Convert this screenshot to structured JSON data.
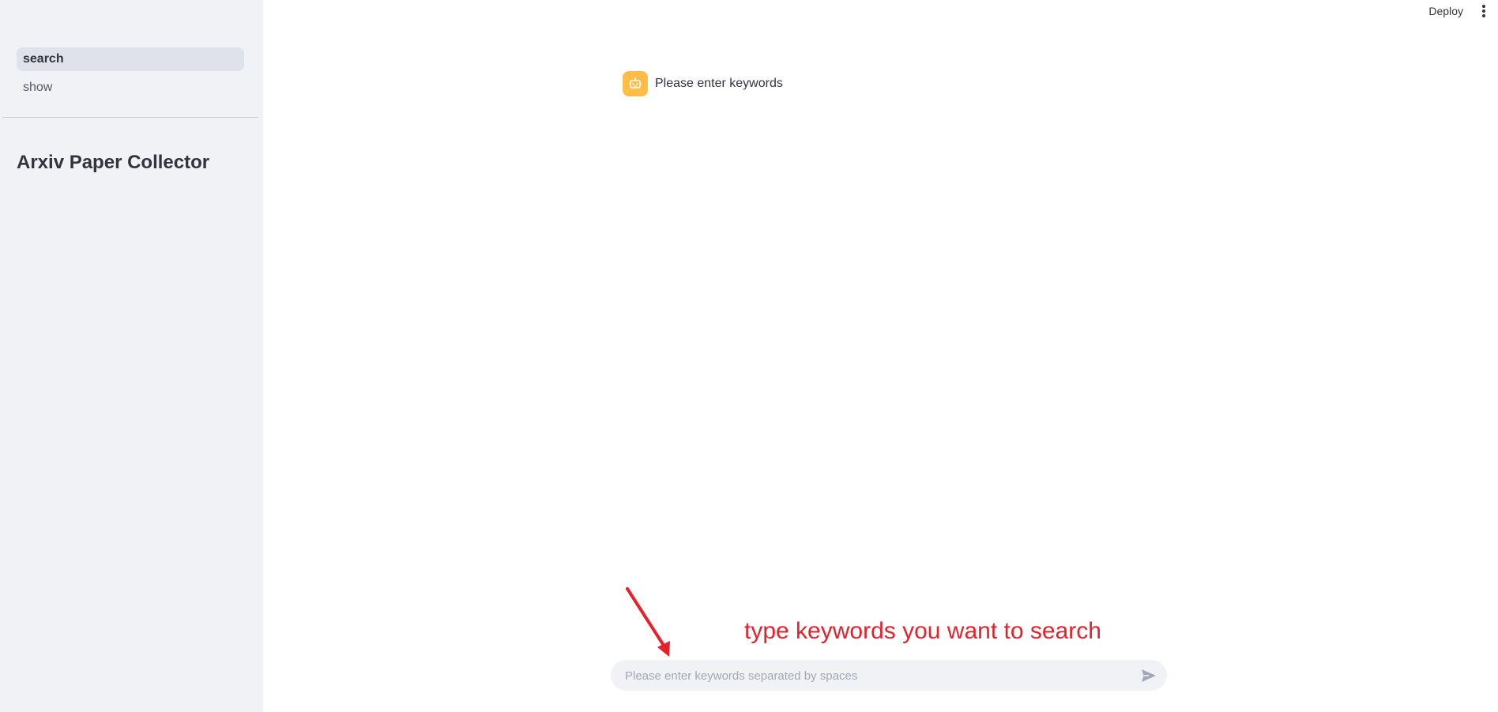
{
  "sidebar": {
    "nav": [
      {
        "label": "search",
        "active": true
      },
      {
        "label": "show",
        "active": false
      }
    ],
    "title": "Arxiv Paper Collector"
  },
  "header": {
    "deploy_label": "Deploy",
    "menu_icon": "vertical-ellipsis-icon"
  },
  "chat": {
    "messages": [
      {
        "role": "assistant",
        "avatar_icon": "robot-icon",
        "avatar_color": "#ffbd45",
        "text": "Please enter keywords"
      }
    ],
    "input": {
      "value": "",
      "placeholder": "Please enter keywords separated by spaces",
      "send_icon": "send-icon"
    }
  },
  "annotation": {
    "text": "type keywords you want to search",
    "color": "#e8202a",
    "arrow_icon": "arrow-icon"
  }
}
